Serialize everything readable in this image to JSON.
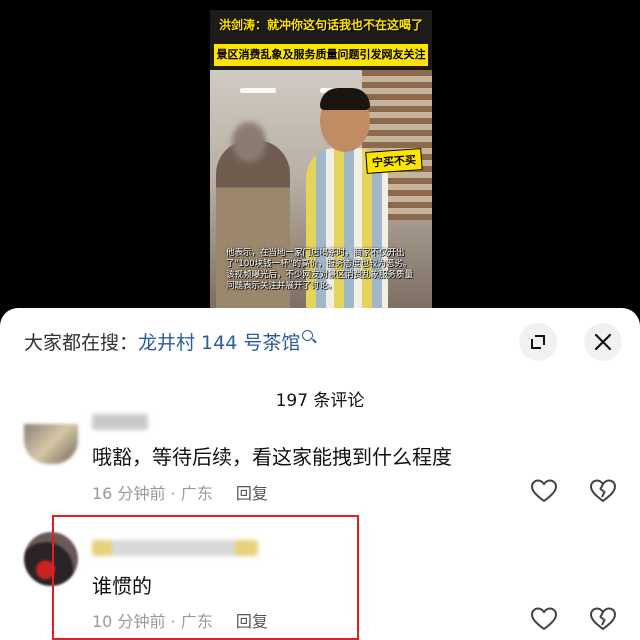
{
  "video": {
    "title": "洪剑涛：就冲你这句话我也不在这喝了",
    "banner": "景区消费乱象及服务质量问题引发网友关注",
    "sticker": "宁买不买",
    "caption": "他表示，在当地一家门店喝茶时，商家不仅开出了\"100块钱一杯\"的高价，服务态度也较为恶劣。该视频曝光后，不少网友对景区消费乱象服务质量问题表示关注并展开了讨论。"
  },
  "sheet": {
    "hot_search_prefix": "大家都在搜：",
    "hot_search_term": "龙井村 144 号茶馆",
    "comment_count": "197 条评论"
  },
  "comments": [
    {
      "text": "哦豁，等待后续，看这家能拽到什么程度",
      "time": "16 分钟前",
      "location": "· 广东",
      "reply": "回复"
    },
    {
      "text": "谁惯的",
      "time": "10 分钟前",
      "location": "· 广东",
      "reply": "回复"
    }
  ],
  "colors": {
    "highlight": "#e02020",
    "link": "#2a5d9a",
    "banner": "#ffe400"
  },
  "icons": [
    "search-icon",
    "expand-icon",
    "close-icon",
    "heart-icon",
    "broken-heart-icon"
  ]
}
